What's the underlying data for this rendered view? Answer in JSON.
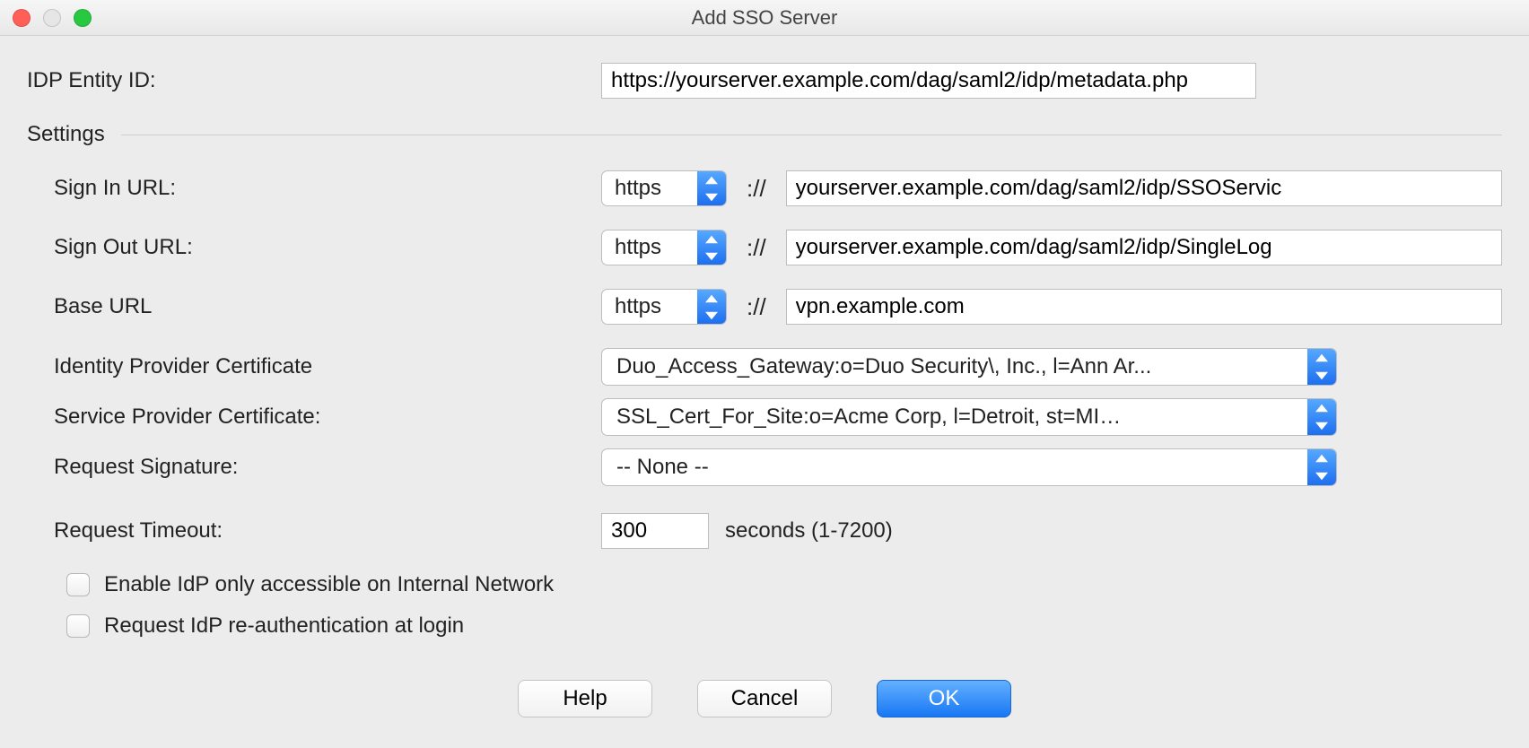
{
  "window": {
    "title": "Add SSO Server"
  },
  "idp": {
    "label": "IDP Entity ID:",
    "value": "https://yourserver.example.com/dag/saml2/idp/metadata.php"
  },
  "settings": {
    "heading": "Settings",
    "signin": {
      "label": "Sign In URL:",
      "protocol": "https",
      "sep": "://",
      "value": "yourserver.example.com/dag/saml2/idp/SSOServic"
    },
    "signout": {
      "label": "Sign Out URL:",
      "protocol": "https",
      "sep": "://",
      "value": "yourserver.example.com/dag/saml2/idp/SingleLog"
    },
    "base": {
      "label": "Base URL",
      "protocol": "https",
      "sep": "://",
      "value": "vpn.example.com"
    },
    "idp_cert": {
      "label": "Identity Provider Certificate",
      "value": "Duo_Access_Gateway:o=Duo Security\\, Inc., l=Ann Ar..."
    },
    "sp_cert": {
      "label": "Service Provider Certificate:",
      "value": "SSL_Cert_For_Site:o=Acme Corp, l=Detroit, st=MI…"
    },
    "req_sig": {
      "label": "Request Signature:",
      "value": "-- None --"
    },
    "timeout": {
      "label": "Request Timeout:",
      "value": "300",
      "suffix": "seconds (1-7200)"
    },
    "chk_internal": {
      "label": "Enable IdP only accessible on Internal Network"
    },
    "chk_reauth": {
      "label": "Request IdP re-authentication at login"
    }
  },
  "buttons": {
    "help": "Help",
    "cancel": "Cancel",
    "ok": "OK"
  }
}
